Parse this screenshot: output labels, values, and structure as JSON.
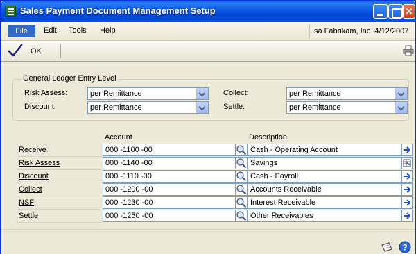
{
  "window": {
    "title": "Sales Payment Document Management Setup"
  },
  "menu": {
    "file": "File",
    "edit": "Edit",
    "tools": "Tools",
    "help": "Help",
    "company_info": "sa  Fabrikam, Inc.  4/12/2007"
  },
  "toolbar": {
    "ok_label": "OK"
  },
  "gl_entry": {
    "group_title": "General Ledger Entry Level",
    "risk_assess_label": "Risk Assess:",
    "risk_assess_value": "per Remittance",
    "discount_label": "Discount:",
    "discount_value": "per Remittance",
    "collect_label": "Collect:",
    "collect_value": "per Remittance",
    "settle_label": "Settle:",
    "settle_value": "per Remittance"
  },
  "accounts": {
    "account_header": "Account",
    "description_header": "Description",
    "rows": [
      {
        "label": "Receive",
        "account": "000 -1100 -00",
        "description": "Cash - Operating Account",
        "expand_icon": "arrow-right-icon"
      },
      {
        "label": "Risk Assess",
        "account": "000 -1140 -00",
        "description": "Savings",
        "expand_icon": "grid-expand-icon"
      },
      {
        "label": "Discount",
        "account": "000 -1110 -00",
        "description": "Cash - Payroll",
        "expand_icon": "arrow-right-icon"
      },
      {
        "label": "Collect",
        "account": "000 -1200 -00",
        "description": "Accounts Receivable",
        "expand_icon": "arrow-right-icon"
      },
      {
        "label": "NSF",
        "account": "000 -1230 -00",
        "description": "Interest Receivable",
        "expand_icon": "arrow-right-icon"
      },
      {
        "label": "Settle",
        "account": "000 -1250 -00",
        "description": "Other Receivables",
        "expand_icon": "arrow-right-icon"
      }
    ]
  },
  "colors": {
    "title_bar": "#0054e3",
    "window_bg": "#ece9d8",
    "field_border": "#7f9db9",
    "link_arrow": "#1c4fd1"
  }
}
